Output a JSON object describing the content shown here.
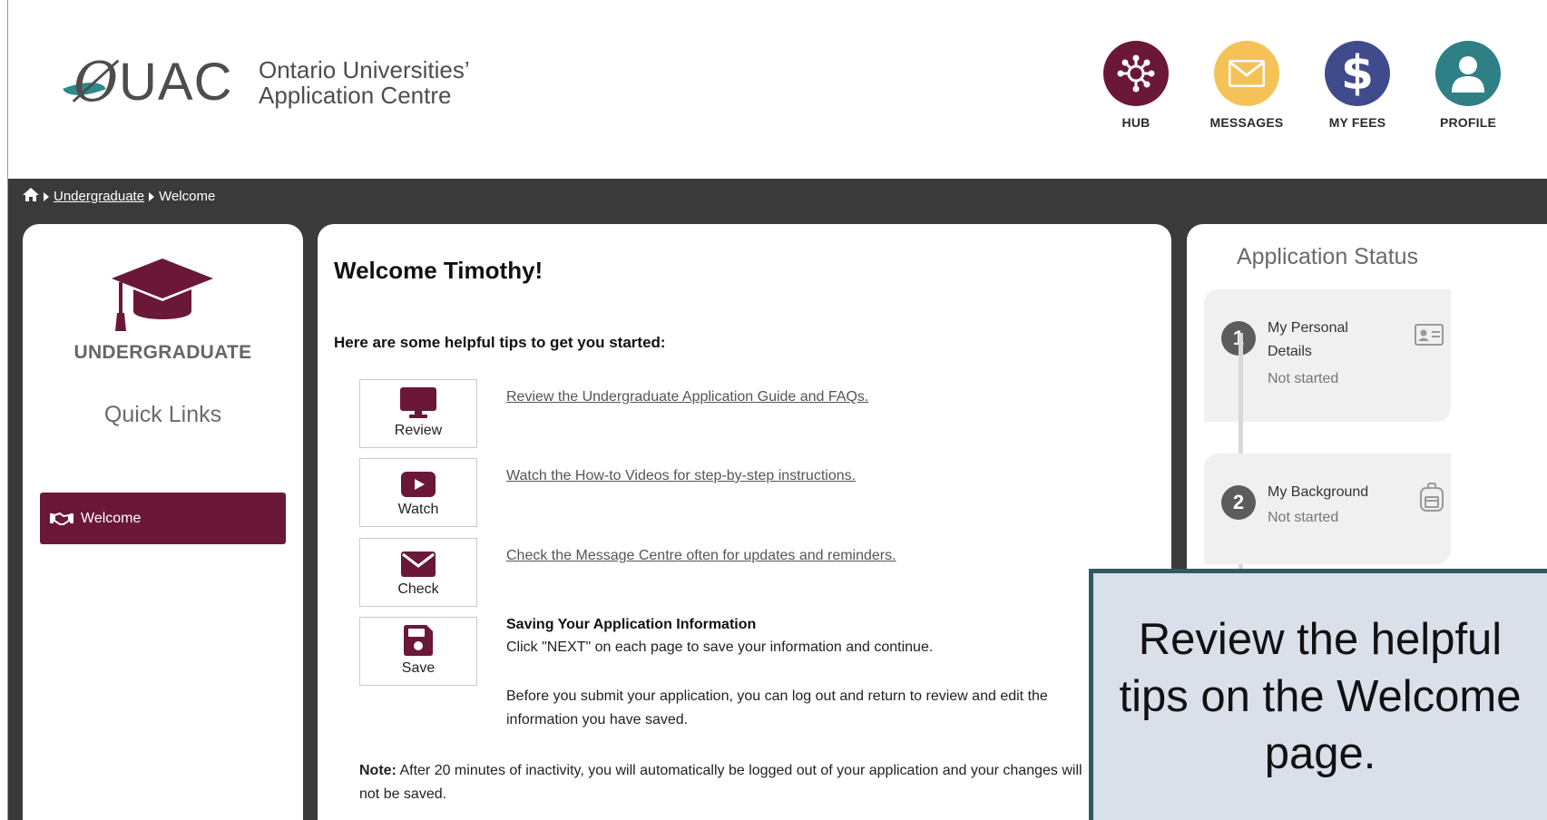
{
  "header": {
    "logo_mark": "UAC",
    "logo_text_line1": "Ontario Universities’",
    "logo_text_line2": "Application Centre",
    "nav": [
      {
        "label": "HUB",
        "color": "#6b1838"
      },
      {
        "label": "MESSAGES",
        "color": "#f4c257"
      },
      {
        "label": "MY FEES",
        "color": "#3f4b8c"
      },
      {
        "label": "PROFILE",
        "color": "#2f7f86"
      }
    ]
  },
  "breadcrumb": {
    "link": "Undergraduate",
    "current": "Welcome"
  },
  "sidebar": {
    "title": "UNDERGRADUATE",
    "quick_links_title": "Quick Links",
    "items": [
      {
        "label": "Welcome",
        "color": "#6b1838"
      }
    ]
  },
  "main": {
    "title": "Welcome Timothy!",
    "tips_title": "Here are some helpful tips to get you started:",
    "tips": [
      {
        "label": "Review",
        "link": "Review the Undergraduate Application Guide and FAQs.",
        "icon": "monitor-icon"
      },
      {
        "label": "Watch",
        "link": "Watch the How-to Videos for step-by-step instructions.",
        "icon": "play-icon"
      },
      {
        "label": "Check",
        "link": "Check the Message Centre often for updates and reminders.",
        "icon": "envelope-icon"
      },
      {
        "label": "Save",
        "icon": "floppy-disk-icon"
      }
    ],
    "save_heading": "Saving Your Application Information",
    "save_text": "Click \"NEXT\" on each page to save your information and continue.",
    "save_text2": "Before you submit your application, you can log out and return to review and edit the information you have saved.",
    "note_label": "Note:",
    "note_text": "After 20 minutes of inactivity, you will automatically be logged out of your application and your changes will not be saved."
  },
  "status": {
    "title": "Application Status",
    "steps": [
      {
        "num": "1",
        "name_line1": "My Personal",
        "name_line2": "Details",
        "status": "Not started",
        "icon": "id-card-icon"
      },
      {
        "num": "2",
        "name_line1": "My Background",
        "status": "Not started",
        "icon": "backpack-icon"
      }
    ]
  },
  "callout": {
    "text": "Review the helpful tips on the Welcome page."
  },
  "colors": {
    "brand": "#6b1838",
    "band": "#3a3a3a",
    "callout_bg": "#d9e0ea",
    "callout_border": "#2f5a66"
  }
}
